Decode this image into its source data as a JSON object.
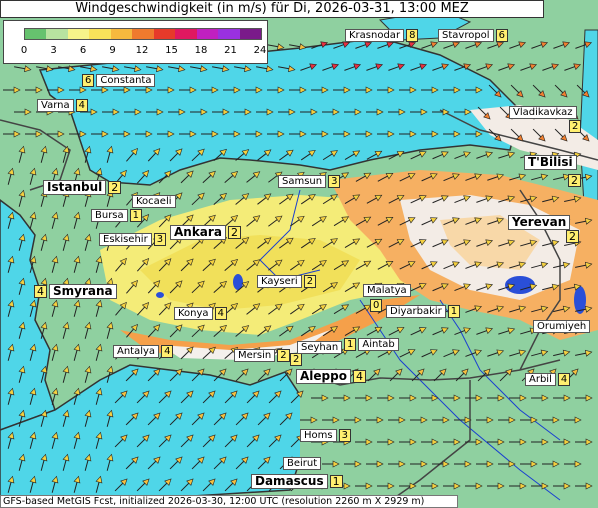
{
  "title": "Windgeschwindigkeit (in m/s) für Di, 2026-03-31, 13:00 MEZ",
  "footer": "GFS-based MetGIS Fcst, initialized 2026-03-30, 12:00 UTC  (resolution 2260 m X 2929 m)",
  "legend": {
    "ticks": [
      "0",
      "3",
      "6",
      "9",
      "12",
      "15",
      "18",
      "21",
      "24"
    ],
    "colors": [
      "#66c26e",
      "#b8e3a0",
      "#f6f48a",
      "#f9e25a",
      "#f6b93e",
      "#ef7a2e",
      "#e63a2a",
      "#e01860",
      "#c020c0",
      "#9a30e0",
      "#7a1a8a"
    ]
  },
  "cities": [
    {
      "id": "krasnodar",
      "name": "Krasnodar",
      "value": "8",
      "big": false
    },
    {
      "id": "stavropol",
      "name": "Stavropol",
      "value": "6",
      "big": false
    },
    {
      "id": "constanta",
      "name": "Constanta",
      "value": "6",
      "big": false
    },
    {
      "id": "varna",
      "name": "Varna",
      "value": "4",
      "big": false
    },
    {
      "id": "vladikavkaz",
      "name": "Vladikavkaz",
      "value": "2",
      "big": false
    },
    {
      "id": "tbilisi",
      "name": "T'Bilisi",
      "value": "2",
      "big": true
    },
    {
      "id": "samsun",
      "name": "Samsun",
      "value": "3",
      "big": false
    },
    {
      "id": "istanbul",
      "name": "Istanbul",
      "value": "2",
      "big": true
    },
    {
      "id": "kocaeli",
      "name": "Kocaeli",
      "value": "",
      "big": false
    },
    {
      "id": "bursa",
      "name": "Bursa",
      "value": "1",
      "big": false
    },
    {
      "id": "eskisehir",
      "name": "Eskisehir",
      "value": "3",
      "big": false
    },
    {
      "id": "ankara",
      "name": "Ankara",
      "value": "2",
      "big": true
    },
    {
      "id": "yerevan",
      "name": "Yerevan",
      "value": "2",
      "big": true
    },
    {
      "id": "smyrana",
      "name": "Smyrana",
      "value": "4",
      "big": true
    },
    {
      "id": "kayseri",
      "name": "Kayseri",
      "value": "2",
      "big": false
    },
    {
      "id": "malatya",
      "name": "Malatya",
      "value": "0",
      "big": false
    },
    {
      "id": "diyarbakir",
      "name": "Diyarbakir",
      "value": "1",
      "big": false
    },
    {
      "id": "konya",
      "name": "Konya",
      "value": "4",
      "big": false
    },
    {
      "id": "orumiyeh",
      "name": "Orumiyeh",
      "value": "",
      "big": false
    },
    {
      "id": "antalya",
      "name": "Antalya",
      "value": "4",
      "big": false
    },
    {
      "id": "mersin",
      "name": "Mersin",
      "value": "2",
      "big": false
    },
    {
      "id": "seyhan",
      "name": "Seyhan",
      "value": "2",
      "big": false
    },
    {
      "id": "aintab",
      "name": "Aintab",
      "value": "1",
      "big": false
    },
    {
      "id": "aleppo",
      "name": "Aleppo",
      "value": "4",
      "big": true
    },
    {
      "id": "arbil",
      "name": "Arbil",
      "value": "4",
      "big": false
    },
    {
      "id": "homs",
      "name": "Homs",
      "value": "3",
      "big": false
    },
    {
      "id": "beirut",
      "name": "Beirut",
      "value": "",
      "big": false
    },
    {
      "id": "damascus",
      "name": "Damascus",
      "value": "1",
      "big": true
    }
  ]
}
